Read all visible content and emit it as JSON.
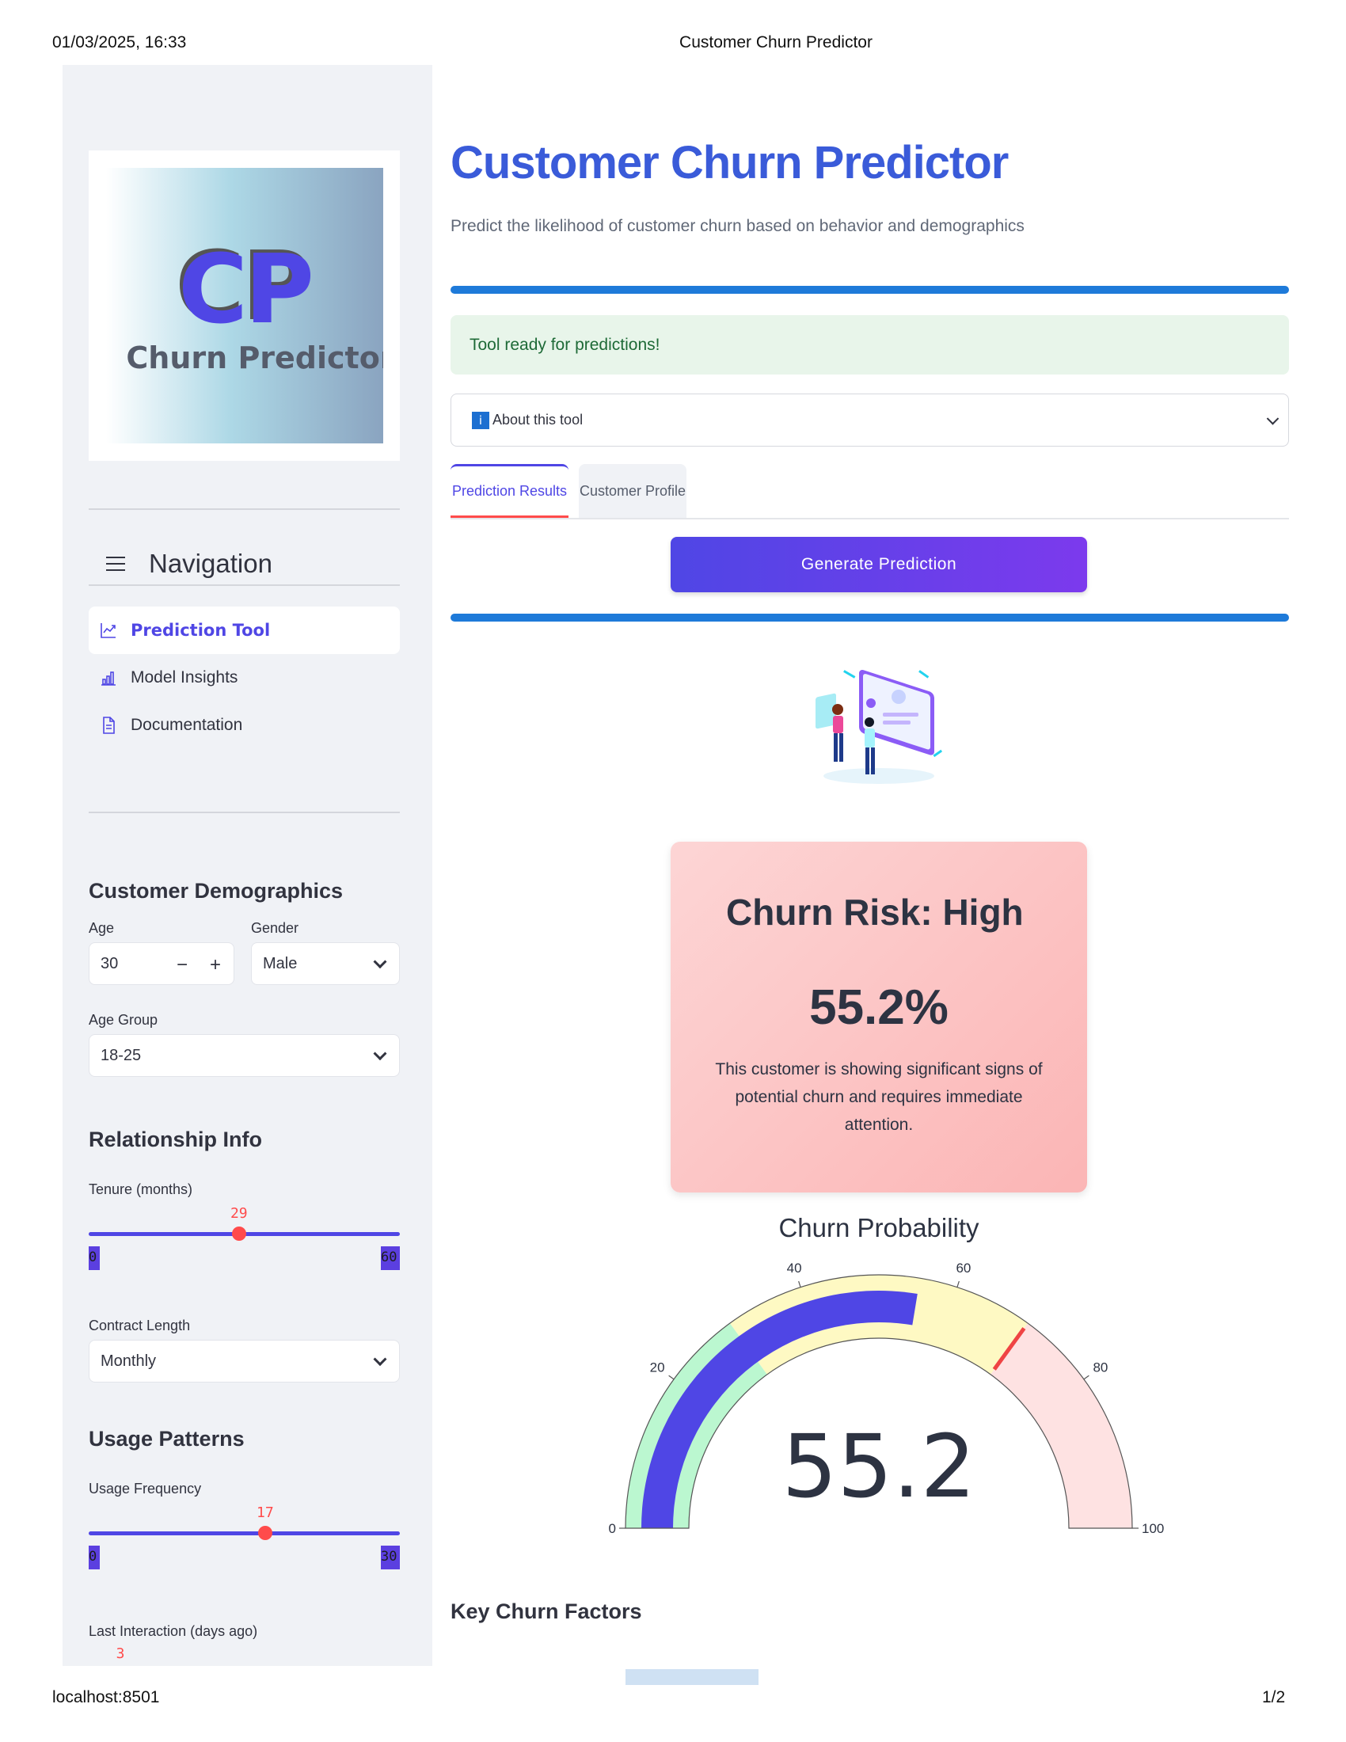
{
  "print": {
    "datetime": "01/03/2025, 16:33",
    "page_title": "Customer Churn Predictor",
    "url": "localhost:8501",
    "page_number": "1/2"
  },
  "sidebar": {
    "logo": {
      "big_text": "CP",
      "sub_text": "Churn Predictor"
    },
    "nav_title": "Navigation",
    "nav_items": [
      {
        "label": "Prediction Tool",
        "icon": "chart-line-icon",
        "active": true
      },
      {
        "label": "Model Insights",
        "icon": "bar-chart-icon",
        "active": false
      },
      {
        "label": "Documentation",
        "icon": "document-icon",
        "active": false
      }
    ],
    "demographics": {
      "title": "Customer Demographics",
      "age_label": "Age",
      "age_value": "30",
      "gender_label": "Gender",
      "gender_value": "Male",
      "age_group_label": "Age Group",
      "age_group_value": "18-25"
    },
    "relationship": {
      "title": "Relationship Info",
      "tenure_label": "Tenure (months)",
      "tenure_value": "29",
      "tenure_min": "0",
      "tenure_max": "60",
      "tenure_fraction": 0.483,
      "contract_label": "Contract Length",
      "contract_value": "Monthly"
    },
    "usage": {
      "title": "Usage Patterns",
      "frequency_label": "Usage Frequency",
      "frequency_value": "17",
      "frequency_min": "0",
      "frequency_max": "30",
      "frequency_fraction": 0.567,
      "last_interaction_label": "Last Interaction (days ago)",
      "last_interaction_value": "3"
    }
  },
  "main": {
    "title": "Customer Churn Predictor",
    "subtitle": "Predict the likelihood of customer churn based on behavior and demographics",
    "success_message": "Tool ready for predictions!",
    "expander_icon": "i",
    "expander_label": "About this tool",
    "tabs": [
      "Prediction Results",
      "Customer Profile"
    ],
    "generate_button": "Generate Prediction",
    "risk_card": {
      "title": "Churn Risk: High",
      "value": "55.2%",
      "description": "This customer is showing significant signs of potential churn and requires immediate attention."
    },
    "key_factors_title": "Key Churn Factors",
    "colors": {
      "accent": "#4f46e5",
      "title_blue": "#3a5bd9",
      "progress_blue": "#1e7ad9",
      "danger": "#ff4b4b"
    }
  },
  "chart_data": {
    "type": "gauge",
    "title": "Churn Probability",
    "value": 55.2,
    "value_label": "55.2",
    "range": [
      0,
      100
    ],
    "ticks": [
      "0",
      "20",
      "40",
      "60",
      "80",
      "100"
    ],
    "bands": [
      {
        "from": 0,
        "to": 30,
        "color": "#bbf7d0"
      },
      {
        "from": 30,
        "to": 70,
        "color": "#fef9c3"
      },
      {
        "from": 70,
        "to": 100,
        "color": "#fee2e2"
      }
    ],
    "bar_color": "#4f46e5",
    "threshold": 70,
    "threshold_color": "#ef4444"
  }
}
